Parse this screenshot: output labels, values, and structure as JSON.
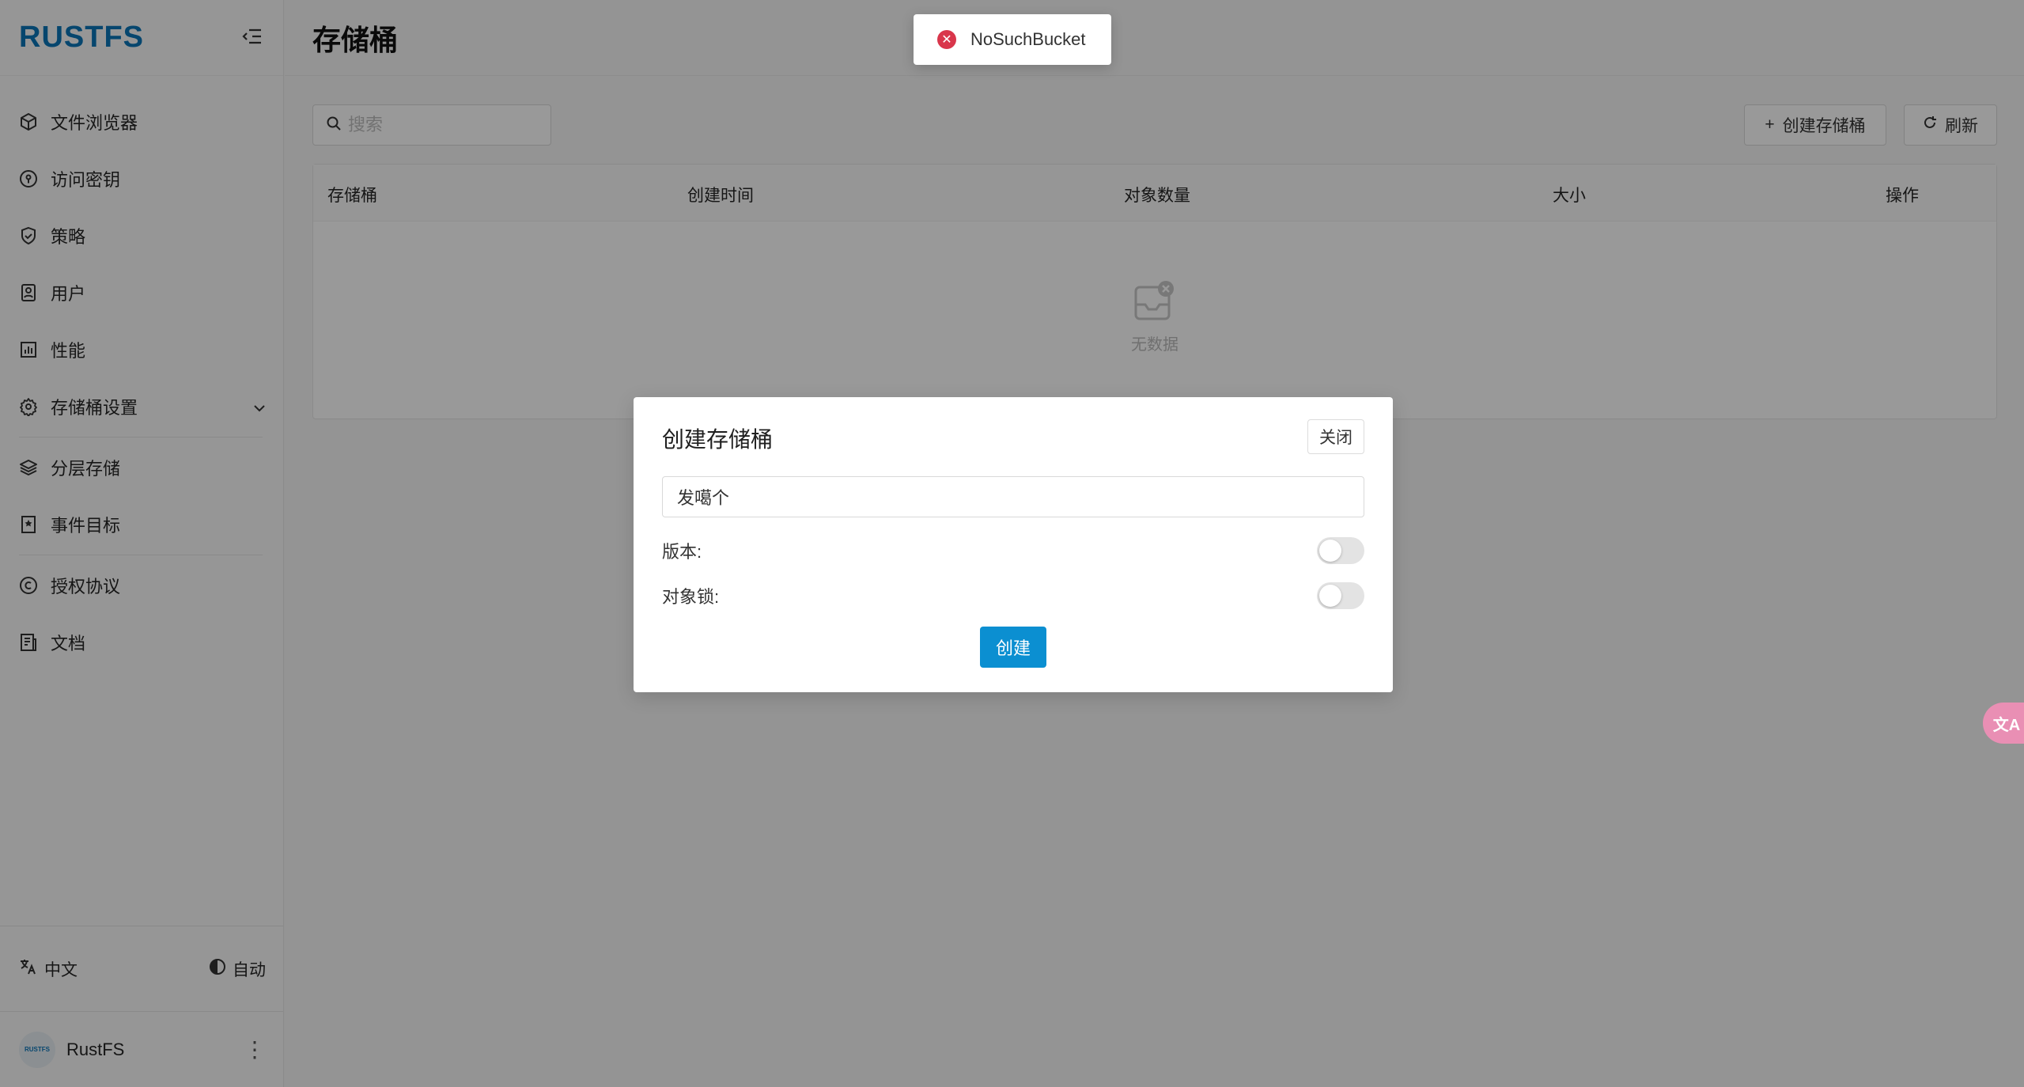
{
  "sidebar": {
    "logo": "RUSTFS",
    "items": [
      {
        "label": "文件浏览器",
        "icon": "cube-icon"
      },
      {
        "label": "访问密钥",
        "icon": "key-icon"
      },
      {
        "label": "策略",
        "icon": "shield-icon"
      },
      {
        "label": "用户",
        "icon": "user-icon"
      },
      {
        "label": "性能",
        "icon": "bar-chart-icon"
      },
      {
        "label": "存储桶设置",
        "icon": "gear-icon"
      },
      {
        "label": "分层存储",
        "icon": "layers-icon"
      },
      {
        "label": "事件目标",
        "icon": "bookmark-icon"
      },
      {
        "label": "授权协议",
        "icon": "copyright-icon"
      },
      {
        "label": "文档",
        "icon": "document-icon"
      }
    ],
    "language": "中文",
    "theme": "自动",
    "user": {
      "name": "RustFS",
      "avatar_text": "RUSTFS"
    }
  },
  "header": {
    "title": "存储桶"
  },
  "toolbar": {
    "search_placeholder": "搜索",
    "create_label": "创建存储桶",
    "refresh_label": "刷新"
  },
  "table": {
    "columns": [
      "存储桶",
      "创建时间",
      "对象数量",
      "大小",
      "操作"
    ],
    "empty_text": "无数据"
  },
  "modal": {
    "title": "创建存储桶",
    "close_label": "关闭",
    "name_value": "发噶个",
    "versioning_label": "版本:",
    "versioning_on": false,
    "object_lock_label": "对象锁:",
    "object_lock_on": false,
    "submit_label": "创建"
  },
  "toast": {
    "message": "NoSuchBucket",
    "type": "error"
  },
  "colors": {
    "brand": "#0b75b8",
    "primary": "#0b8fd1",
    "error": "#d9364b"
  }
}
